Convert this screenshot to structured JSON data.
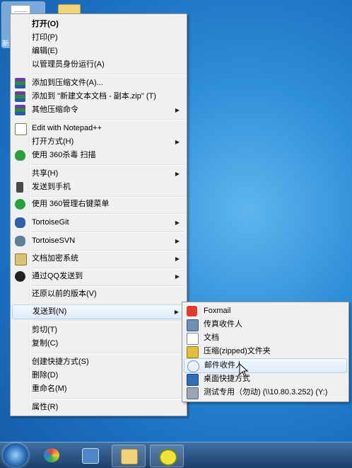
{
  "desktop": {
    "file_label": "新"
  },
  "main_menu": {
    "items": [
      {
        "label": "打开(O)"
      },
      {
        "label": "打印(P)"
      },
      {
        "label": "编辑(E)"
      },
      {
        "label": "以管理员身份运行(A)"
      },
      {
        "label": "添加到压缩文件(A)..."
      },
      {
        "label": "添加到 \"新建文本文档 - 副本.zip\" (T)"
      },
      {
        "label": "其他压缩命令"
      },
      {
        "label": "Edit with Notepad++"
      },
      {
        "label": "打开方式(H)"
      },
      {
        "label": "使用 360杀毒 扫描"
      },
      {
        "label": "共享(H)"
      },
      {
        "label": "发送到手机"
      },
      {
        "label": "使用 360管理右键菜单"
      },
      {
        "label": "TortoiseGit"
      },
      {
        "label": "TortoiseSVN"
      },
      {
        "label": "文档加密系统"
      },
      {
        "label": "通过QQ发送到"
      },
      {
        "label": "还原以前的版本(V)"
      },
      {
        "label": "发送到(N)"
      },
      {
        "label": "剪切(T)"
      },
      {
        "label": "复制(C)"
      },
      {
        "label": "创建快捷方式(S)"
      },
      {
        "label": "删除(D)"
      },
      {
        "label": "重命名(M)"
      },
      {
        "label": "属性(R)"
      }
    ],
    "submenu_arrow": "▶"
  },
  "send_to_menu": {
    "items": [
      {
        "label": "Foxmail"
      },
      {
        "label": "传真收件人"
      },
      {
        "label": "文档"
      },
      {
        "label": "压缩(zipped)文件夹"
      },
      {
        "label": "邮件收件人"
      },
      {
        "label": "桌面快捷方式"
      },
      {
        "label": "测试专用（勿动) (\\\\10.80.3.252) (Y:)"
      }
    ]
  }
}
